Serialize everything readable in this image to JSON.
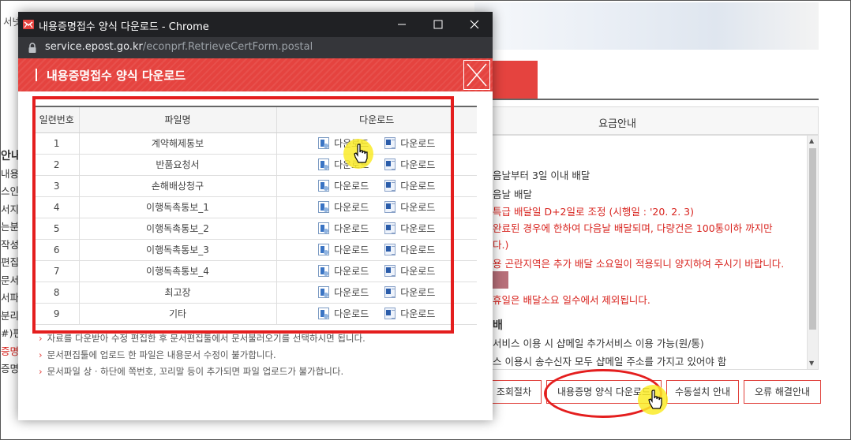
{
  "background": {
    "side_text_top": "서넷화",
    "fee_header": "요금안내",
    "lines": [
      {
        "text": "음날부터 3일 이내 배달",
        "red": false
      },
      {
        "text": "음날 배달",
        "red": false
      },
      {
        "text": "특급 배달일 D+2일로 조정 (시행일 : '20. 2. 3)",
        "red": true
      },
      {
        "text": "완료된 경우에 한하여 다음날 배달되며, 다량건은 100통이하 까지만",
        "red": true
      },
      {
        "text": "다.)",
        "red": true
      },
      {
        "text": "용 곤란지역은 추가 배달 소요일이 적용되니 양지하여 주시기 바랍니다.",
        "red": true
      },
      {
        "text": "휴일은 배달소요 일수에서 제외됩니다.",
        "red": true
      },
      {
        "text": "배",
        "red": false
      },
      {
        "text": "서비스 이용 시 샵메일 추가서비스 이용 가능(원/통)",
        "red": false
      },
      {
        "text": "스 이용시 송수신자 모두 샵메일 주소를 가지고 있어야 함",
        "red": false
      }
    ],
    "left_fragments": [
      {
        "text": "안내",
        "red": false
      },
      {
        "text": "내용",
        "red": false
      },
      {
        "text": "스인",
        "red": false
      },
      {
        "text": "서지름",
        "red": false
      },
      {
        "text": "는분",
        "red": false
      },
      {
        "text": "작성",
        "red": false
      },
      {
        "text": "편집",
        "red": false
      },
      {
        "text": "문서",
        "red": false
      },
      {
        "text": "서파",
        "red": false
      },
      {
        "text": "분리",
        "red": false
      },
      {
        "text": "#)편",
        "red": false
      },
      {
        "text": "증명",
        "red": true
      },
      {
        "text": "증명",
        "red": false
      }
    ],
    "buttons": {
      "lookup": "조회절차",
      "download_form": "내용증명 양식 다운로드",
      "manual_install": "수동설치 안내",
      "error_guide": "오류 해결안내"
    }
  },
  "window": {
    "title": "내용증명접수 양식 다운로드 - Chrome",
    "url_host": "service.epost.go.kr",
    "url_path": "/econprf.RetrieveCertForm.postal"
  },
  "popup": {
    "title": "내용증명접수 양식 다운로드",
    "table": {
      "headers": [
        "일련번호",
        "파일명",
        "다운로드"
      ],
      "download_label": "다운로드",
      "rows": [
        {
          "no": "1",
          "name": "계약해제통보"
        },
        {
          "no": "2",
          "name": "반품요청서"
        },
        {
          "no": "3",
          "name": "손해배상청구"
        },
        {
          "no": "4",
          "name": "이행독촉통보_1"
        },
        {
          "no": "5",
          "name": "이행독촉통보_2"
        },
        {
          "no": "6",
          "name": "이행독촉통보_3"
        },
        {
          "no": "7",
          "name": "이행독촉통보_4"
        },
        {
          "no": "8",
          "name": "최고장"
        },
        {
          "no": "9",
          "name": "기타"
        }
      ]
    },
    "notes": [
      "자료를 다운받아 수정 편집한 후 문서편집툴에서 문서불러오기를 선택하시면 됩니다.",
      "문서편집툴에 업로드 한 파일은 내용문서 수정이 불가합니다.",
      "문서파일 상 · 하단에 쪽번호, 꼬리말 등이 추가되면 파일 업로드가 불가합니다."
    ]
  },
  "colors": {
    "brand_red": "#e5433f",
    "annotation_red": "#e41e1e",
    "highlight_yellow": "#faeb28",
    "titlebar": "#202124"
  },
  "icons": [
    "app-icon",
    "lock-icon",
    "hwp-file-icon",
    "word-file-icon",
    "close-icon",
    "hand-cursor-icon"
  ]
}
